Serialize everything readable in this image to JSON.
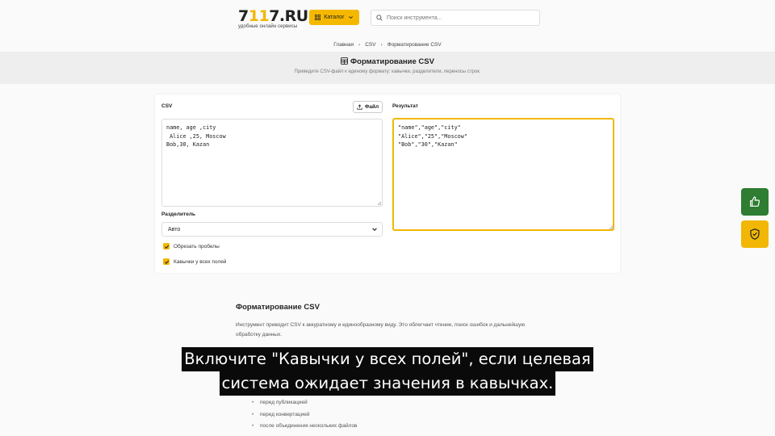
{
  "header": {
    "logo_prefix": "7",
    "logo_accent": "11",
    "logo_suffix": "7.RU",
    "logo_tagline": "удобные онлайн сервисы",
    "catalog_label": "Каталог",
    "search_placeholder": "Поиск инструмента..."
  },
  "breadcrumb": [
    "Главная",
    "CSV",
    "Форматирование CSV"
  ],
  "page": {
    "title": "Форматирование CSV",
    "subtitle": "Приведите CSV-файл к единому формату: кавычки, разделители, переносы строк."
  },
  "tool": {
    "input_label": "CSV",
    "file_button": "Файл",
    "input_value": "name, age ,city\n Alice ,25, Moscow\nBob,30, Kazan",
    "result_label": "Результат",
    "result_value": "\"name\",\"age\",\"city\"\n\"Alice\",\"25\",\"Moscow\"\n\"Bob\",\"30\",\"Kazan\"",
    "delimiter_label": "Разделитель",
    "delimiter_value": "Авто",
    "options": [
      {
        "label": "Обрезать пробелы",
        "checked": true
      },
      {
        "label": "Кавычки у всех полей",
        "checked": true
      }
    ]
  },
  "side_buttons": [
    {
      "icon": "thumbs-up-icon",
      "color": "#2e7d32"
    },
    {
      "icon": "shield-check-icon",
      "color": "#f2b705"
    }
  ],
  "article": {
    "title": "Форматирование CSV",
    "text": "Инструмент приводит CSV к аккуратному и единообразному виду. Это облегчает чтение, поиск ошибок и дальнейшую обработку данных.",
    "list": [
      "перед публикацией",
      "перед конвертацией",
      "после объединения нескольких файлов"
    ]
  },
  "caption": {
    "line1": "Включите \"Кавычки у всех полей\", если целевая",
    "line2": "система ожидает значения в кавычках."
  },
  "colors": {
    "accent": "#f2b705",
    "green": "#2e7d32"
  }
}
